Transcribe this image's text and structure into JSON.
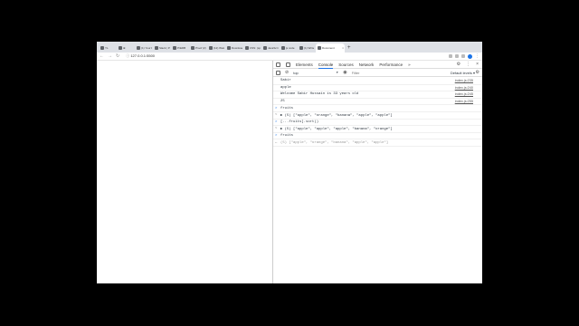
{
  "browser": {
    "tabs": [
      {
        "label": "YL"
      },
      {
        "label": "⊕"
      },
      {
        "label": "(1) Your Ema"
      },
      {
        "label": "Slack | Proj"
      },
      {
        "label": "PrEDB"
      },
      {
        "label": "Proof (2)"
      },
      {
        "label": "(12) Welco"
      },
      {
        "label": "Download"
      },
      {
        "label": "CSS: (space"
      },
      {
        "label": "JavaScri"
      },
      {
        "label": "js code"
      },
      {
        "label": "(1) Write"
      },
      {
        "label": "Document",
        "active": true
      }
    ],
    "new_tab": "+",
    "nav": {
      "back": "←",
      "forward": "→",
      "reload": "↻"
    },
    "url": "127.0.0.1:5500"
  },
  "devtools": {
    "tabs": [
      "Elements",
      "Console",
      "Sources",
      "Network",
      "Performance"
    ],
    "active_tab": "Console",
    "more": "»",
    "settings_icon": "⚙",
    "menu_icon": "⋮",
    "close_icon": "×",
    "context": "top",
    "filter_placeholder": "Filter",
    "levels": "Default levels ▾",
    "console_lines": [
      {
        "text": "Sabir",
        "src": "index.js:235",
        "kind": "log"
      },
      {
        "text": "apple",
        "src": "index.js:240",
        "kind": "log"
      },
      {
        "text": "Welcome Sabir Hussain is 33 years old",
        "src": "index.js:245",
        "kind": "log"
      },
      {
        "text": "25",
        "src": "index.js:255",
        "kind": "log"
      },
      {
        "text": "fruits",
        "src": "",
        "kind": "input",
        "prefix": ">"
      },
      {
        "text": "▶ (5) [\"apple\", \"orange\", \"banana\", \"apple\", \"apple\"]",
        "src": "",
        "kind": "result",
        "prefix": "<"
      },
      {
        "text": "[...fruits].sort()",
        "src": "",
        "kind": "input",
        "prefix": ">"
      },
      {
        "text": "▶ (5) [\"apple\", \"apple\", \"apple\", \"banana\", \"orange\"]",
        "src": "",
        "kind": "result",
        "prefix": "<"
      },
      {
        "text": "fruits",
        "src": "",
        "kind": "input",
        "prefix": ">"
      },
      {
        "text": "(5) [\"apple\", \"orange\", \"banana\", \"apple\", \"apple\"]",
        "src": "",
        "kind": "ghost",
        "prefix": "←"
      }
    ]
  }
}
